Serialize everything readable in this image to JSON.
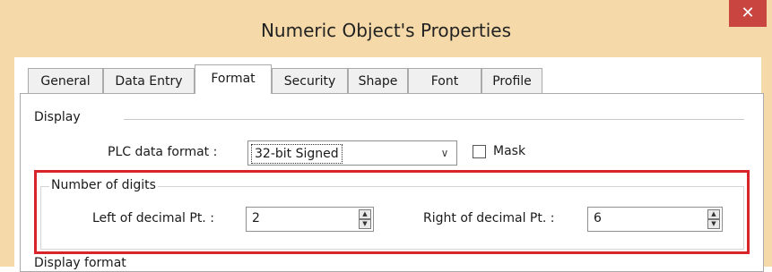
{
  "window": {
    "title": "Numeric Object's Properties",
    "close_glyph": "✕"
  },
  "tabs": [
    {
      "label": "General"
    },
    {
      "label": "Data Entry"
    },
    {
      "label": "Format"
    },
    {
      "label": "Security"
    },
    {
      "label": "Shape"
    },
    {
      "label": "Font"
    },
    {
      "label": "Profile"
    }
  ],
  "active_tab": "Format",
  "display": {
    "section_label": "Display",
    "plc_label": "PLC data format :",
    "plc_value": "32-bit Signed",
    "dropdown_glyph": "∨",
    "mask_label": "Mask",
    "mask_checked": false
  },
  "digits": {
    "group_label": "Number of digits",
    "left_label": "Left of decimal Pt. :",
    "left_value": "2",
    "right_label": "Right of decimal Pt. :",
    "right_value": "6",
    "spin_up_glyph": "▲",
    "spin_down_glyph": "▼"
  },
  "display_format_label": "Display format",
  "colors": {
    "highlight": "#d9242b",
    "titlebar": "#f5d9a8",
    "close": "#c9453f"
  }
}
